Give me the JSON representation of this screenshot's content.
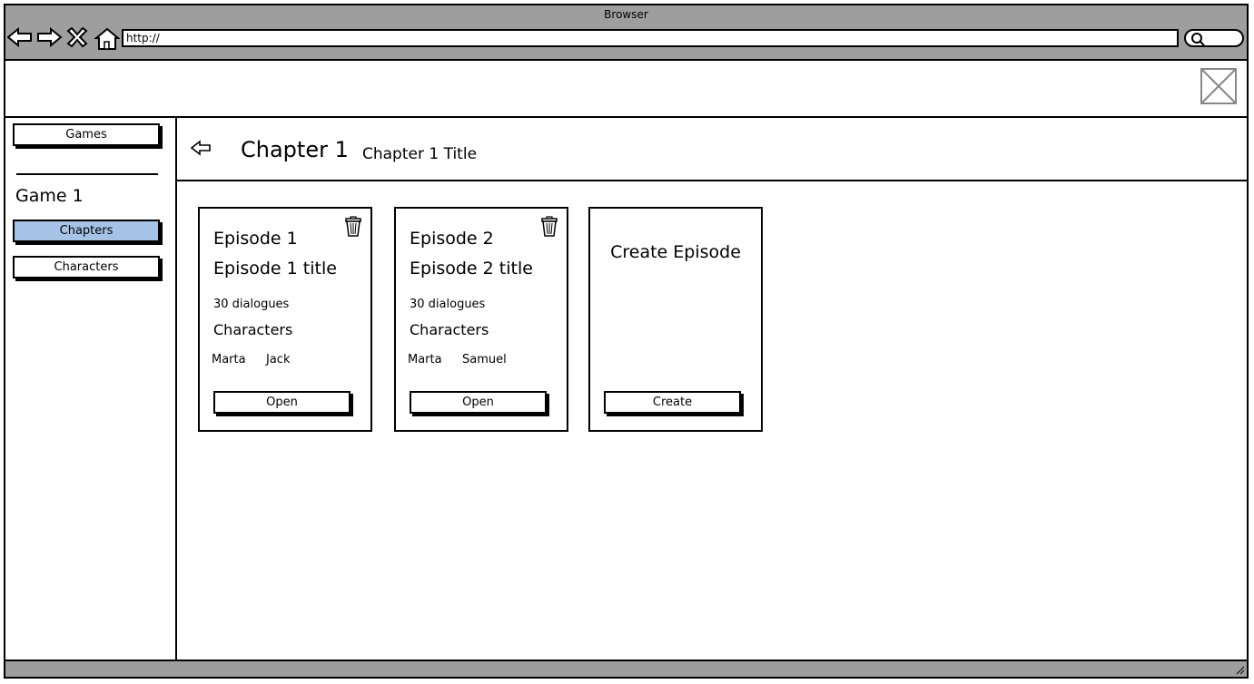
{
  "browser": {
    "title": "Browser",
    "url": "http://"
  },
  "sidebar": {
    "games_label": "Games",
    "game_title": "Game 1",
    "items": [
      {
        "label": "Chapters",
        "active": true
      },
      {
        "label": "Characters",
        "active": false
      }
    ]
  },
  "header": {
    "chapter": "Chapter 1",
    "chapter_title": "Chapter 1 Title"
  },
  "episodes": [
    {
      "number": "Episode 1",
      "title": "Episode 1 title",
      "dialogues": "30 dialogues",
      "characters_heading": "Characters",
      "characters": [
        "Marta",
        "Jack"
      ],
      "open_label": "Open"
    },
    {
      "number": "Episode 2",
      "title": "Episode 2 title",
      "dialogues": "30 dialogues",
      "characters_heading": "Characters",
      "characters": [
        "Marta",
        "Samuel"
      ],
      "open_label": "Open"
    }
  ],
  "create_card": {
    "heading": "Create Episode",
    "button_label": "Create"
  },
  "colors": {
    "chrome": "#9e9e9e",
    "active_nav": "#a4c3e6"
  }
}
